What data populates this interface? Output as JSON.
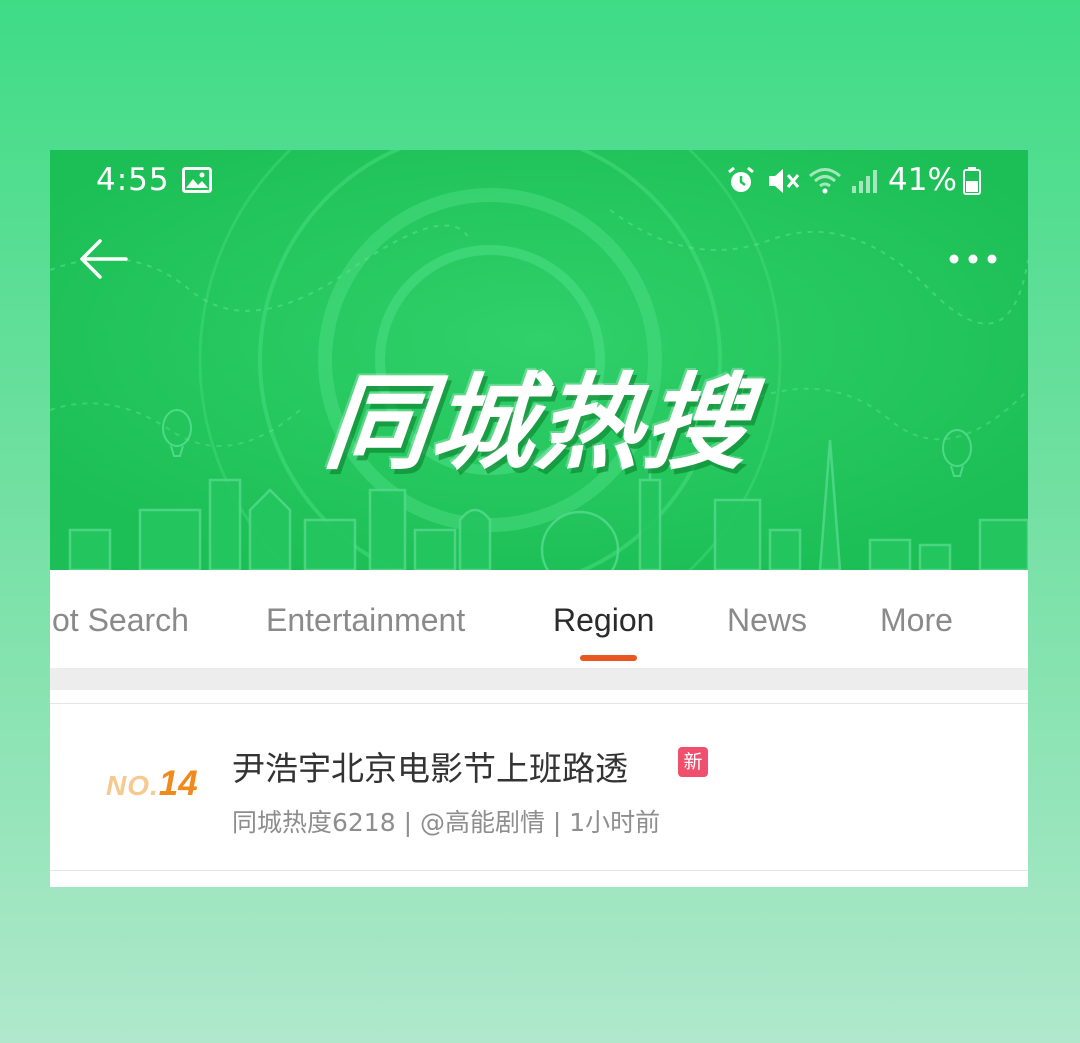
{
  "colors": {
    "page_bg_top": "#3fdc86",
    "page_bg_bottom": "#b0e8cc",
    "hero_green": "#1fc45a",
    "accent_orange": "#e8571f",
    "new_badge": "#f0506e"
  },
  "status_bar": {
    "time": "4:55",
    "battery": "41%",
    "icons": [
      "image-icon",
      "alarm-icon",
      "mute-icon",
      "wifi-icon",
      "signal-icon",
      "battery-icon"
    ]
  },
  "header": {
    "back_icon": "back-arrow-icon",
    "more_icon": "more-dots-icon",
    "title": "同城热搜"
  },
  "tabs": [
    {
      "label": "ot Search"
    },
    {
      "label": "Entertainment"
    },
    {
      "label": "Region",
      "active": true
    },
    {
      "label": "News"
    },
    {
      "label": "More"
    }
  ],
  "list": [
    {
      "rank_prefix": "NO.",
      "rank_number": "14",
      "title": "尹浩宇北京电影节上班路透",
      "badge": "新",
      "meta": "同城热度6218 | @高能剧情 | 1小时前"
    }
  ]
}
